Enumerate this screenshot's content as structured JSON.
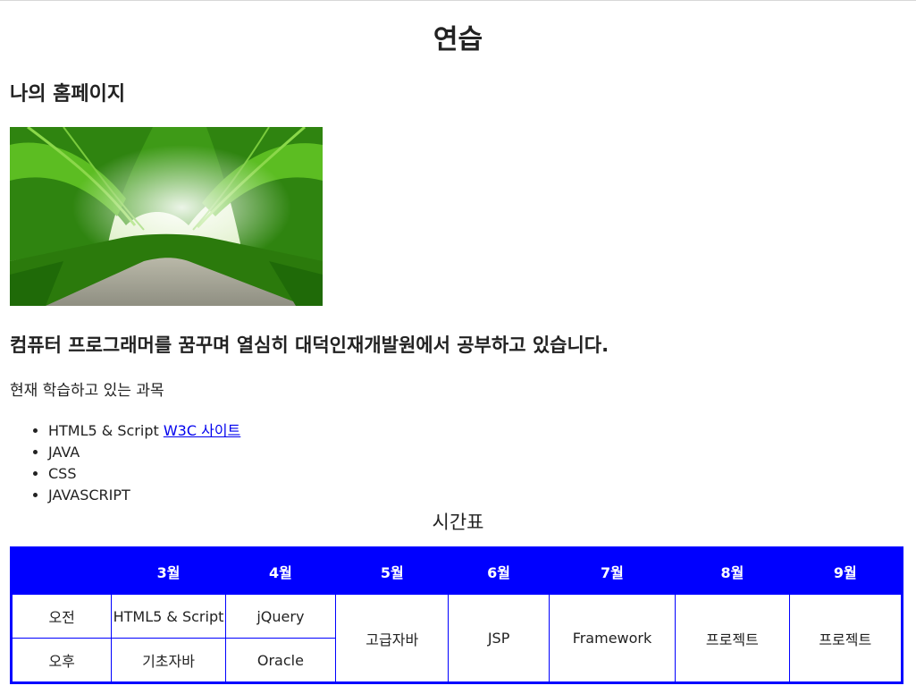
{
  "page": {
    "title": "연습",
    "site_title": "나의 홈페이지",
    "intro": "컴퓨터 프로그래머를 꿈꾸며 열심히 대덕인재개발원에서 공부하고 있습니다.",
    "subjects_label": "현재 학습하고 있는 과목",
    "subjects": [
      {
        "text": "HTML5 & Script ",
        "link": "W3C 사이트"
      },
      {
        "text": "JAVA"
      },
      {
        "text": "CSS"
      },
      {
        "text": "JAVASCRIPT"
      }
    ],
    "table_caption": "시간표"
  },
  "schedule": {
    "header_color": "#0000ff",
    "headers": [
      "",
      "3월",
      "4월",
      "5월",
      "6월",
      "7월",
      "8월",
      "9월"
    ],
    "row_labels": [
      "오전",
      "오후"
    ],
    "march": [
      "HTML5 & Script",
      "기초자바"
    ],
    "april": [
      "jQuery",
      "Oracle"
    ],
    "may": "고급자바",
    "june": "JSP",
    "july": "Framework",
    "august": "프로젝트",
    "september": "프로젝트"
  }
}
